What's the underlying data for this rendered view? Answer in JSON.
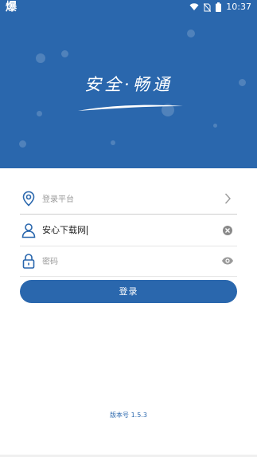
{
  "status_bar": {
    "app_glyph": "爆",
    "time": "10:37",
    "icons": [
      "wifi-icon",
      "no-sim-icon",
      "battery-icon"
    ]
  },
  "header": {
    "slogan": "安全·畅通",
    "background_color": "#2a67ad"
  },
  "form": {
    "platform": {
      "placeholder": "登录平台",
      "icon": "location-pin-icon",
      "action_icon": "chevron-right-icon"
    },
    "username": {
      "value": "安心下载网",
      "icon": "user-icon",
      "action_icon": "clear-icon"
    },
    "password": {
      "placeholder": "密码",
      "icon": "lock-icon",
      "action_icon": "eye-icon"
    }
  },
  "login_button": {
    "label": "登录"
  },
  "footer": {
    "version": "版本号 1.5.3"
  }
}
